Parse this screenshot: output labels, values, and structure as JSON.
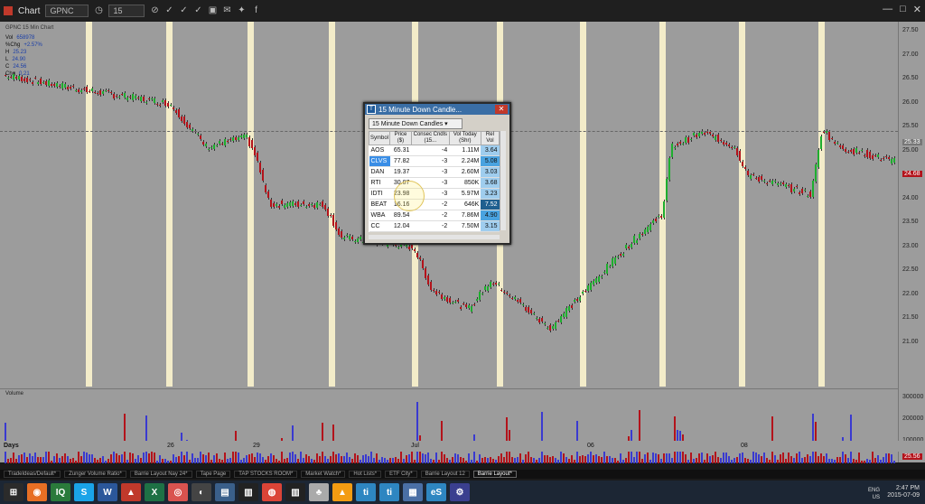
{
  "window": {
    "title": "Chart",
    "symbol": "GPNC",
    "timeframe": "15"
  },
  "chart": {
    "study_label": "GPNC 15 Min Chart",
    "readout": [
      {
        "k": "Vol",
        "v": "658978"
      },
      {
        "k": "%Chg",
        "v": "+2.57%"
      },
      {
        "k": "H",
        "v": "25.23"
      },
      {
        "k": "L",
        "v": "24.90"
      },
      {
        "k": "C",
        "v": "24.56"
      },
      {
        "k": "Chg",
        "v": "0.21"
      }
    ],
    "y_ticks": [
      "27.50",
      "27.00",
      "26.50",
      "26.00",
      "25.50",
      "25.00",
      "24.50",
      "24.00",
      "23.50",
      "23.00",
      "22.50",
      "22.00",
      "21.50",
      "21.00"
    ],
    "y_last": "24.68",
    "y_mid": "25.33",
    "vol_ticks": [
      "300000",
      "200000",
      "100000"
    ],
    "vol_last": "25.56",
    "x_ticks": [
      "26",
      "29",
      "Jul",
      "06",
      "08"
    ],
    "x_left": "Days",
    "volume_label": "Volume"
  },
  "scanner": {
    "title": "15 Minute Down Candle...",
    "dropdown": "15 Minute Down Candles",
    "columns": [
      "Symbol",
      "Price ($)",
      "Consec Cndls (15...",
      "Vol Today (Shr)",
      "Rel Vol"
    ],
    "rows": [
      [
        "AOS",
        "65.31",
        "-4",
        "1.11M",
        "3.64"
      ],
      [
        "CLVS",
        "77.82",
        "-3",
        "2.24M",
        "5.08"
      ],
      [
        "DAN",
        "19.37",
        "-3",
        "2.60M",
        "3.03"
      ],
      [
        "RTI",
        "30.07",
        "-3",
        "850K",
        "3.68"
      ],
      [
        "IDTI",
        "23.98",
        "-3",
        "5.97M",
        "3.23"
      ],
      [
        "BEAT",
        "16.16",
        "-2",
        "646K",
        "7.52"
      ],
      [
        "WBA",
        "89.54",
        "-2",
        "7.86M",
        "4.90"
      ],
      [
        "CC",
        "12.04",
        "-2",
        "7.50M",
        "3.15"
      ]
    ],
    "selected_row": 1
  },
  "task_windows": [
    "TradeIdeas/Default*",
    "Zunger Volume Ratio*",
    "Barrie Layout Nay 24*",
    "Tape Page",
    "TAP STOCKS ROOM*",
    "Market Watch*",
    "Hot Lists*",
    "ETF City*",
    "Barrie Layout 12",
    "Barrie Layout*"
  ],
  "taskbar": {
    "apps": [
      "start",
      "firefox",
      "iq",
      "skype",
      "word",
      "pdf",
      "excel",
      "browser",
      "media",
      "monitor",
      "chart",
      "chrome",
      "chart2",
      "poker",
      "vlc",
      "ti",
      "ti2",
      "screen",
      "es",
      "settings"
    ],
    "lang": "ENG",
    "region": "US",
    "time": "2:47 PM",
    "date": "2015-07-09"
  },
  "colors": {
    "up": "#1fae2f",
    "down": "#b3131b",
    "bg": "#9c9c9c",
    "session": "#f3ecc9",
    "vol_up": "#3a3ad0",
    "vol_dn": "#b3131b"
  }
}
